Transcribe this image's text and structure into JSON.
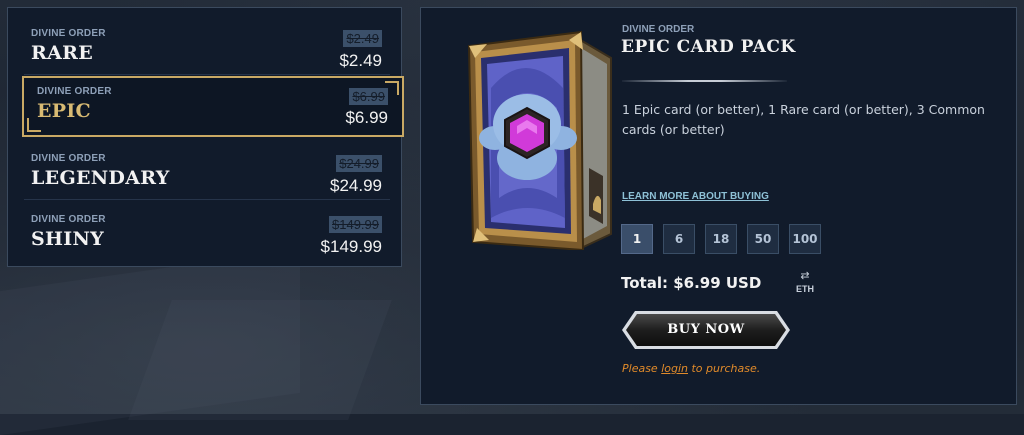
{
  "packs": [
    {
      "order": "DIVINE ORDER",
      "name": "RARE",
      "old_price": "$2.49",
      "price": "$2.49"
    },
    {
      "order": "DIVINE ORDER",
      "name": "EPIC",
      "old_price": "$6.99",
      "price": "$6.99"
    },
    {
      "order": "DIVINE ORDER",
      "name": "LEGENDARY",
      "old_price": "$24.99",
      "price": "$24.99"
    },
    {
      "order": "DIVINE ORDER",
      "name": "SHINY",
      "old_price": "$149.99",
      "price": "$149.99"
    }
  ],
  "selected_pack": "EPIC",
  "detail": {
    "order": "DIVINE ORDER",
    "title": "EPIC CARD PACK",
    "description": "1 Epic card (or better), 1 Rare card (or better), 3 Common cards (or better)",
    "learn_more": "LEARN MORE ABOUT BUYING",
    "quantities": [
      "1",
      "6",
      "18",
      "50",
      "100"
    ],
    "selected_quantity": "1",
    "total": "Total: $6.99 USD",
    "currency_toggle": {
      "icon": "swap-arrows-icon",
      "label": "ETH"
    },
    "buy_label": "BUY NOW",
    "note_before": "Please ",
    "note_link": "login",
    "note_after": " to purchase."
  },
  "colors": {
    "gold_accent": "#c9a964",
    "panel_bg": "#111b2b",
    "note_orange": "#e08a2a",
    "link_blue": "#8ec1d6",
    "gem_magenta": "#d13ad9"
  }
}
